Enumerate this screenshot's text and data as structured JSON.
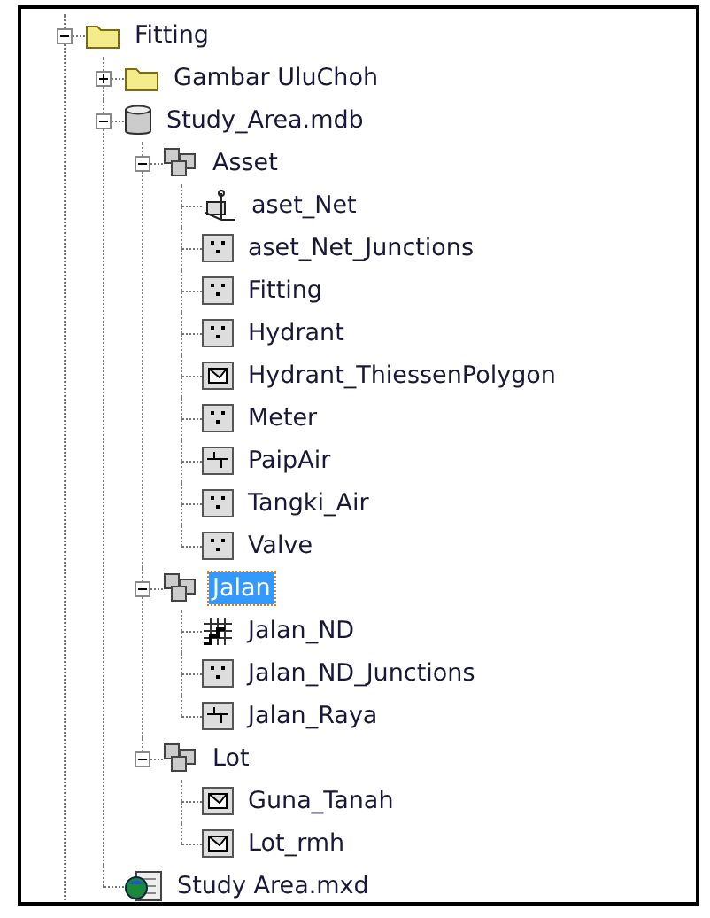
{
  "tree": [
    {
      "label": "Fitting",
      "kind": "folder",
      "expanded": true,
      "selected": false,
      "children": [
        {
          "label": "Gambar UluChoh",
          "kind": "folder",
          "expanded": false,
          "selected": false
        },
        {
          "label": "Study_Area.mdb",
          "kind": "geodatabase",
          "expanded": true,
          "selected": false,
          "children": [
            {
              "label": "Asset",
              "kind": "dataset",
              "expanded": true,
              "selected": false,
              "children": [
                {
                  "label": "aset_Net",
                  "kind": "geometric_network",
                  "selected": false
                },
                {
                  "label": "aset_Net_Junctions",
                  "kind": "point",
                  "selected": false
                },
                {
                  "label": "Fitting",
                  "kind": "point",
                  "selected": false
                },
                {
                  "label": "Hydrant",
                  "kind": "point",
                  "selected": false
                },
                {
                  "label": "Hydrant_ThiessenPolygon",
                  "kind": "polygon",
                  "selected": false
                },
                {
                  "label": "Meter",
                  "kind": "point",
                  "selected": false
                },
                {
                  "label": "PaipAir",
                  "kind": "line",
                  "selected": false
                },
                {
                  "label": "Tangki_Air",
                  "kind": "point",
                  "selected": false
                },
                {
                  "label": "Valve",
                  "kind": "point",
                  "selected": false
                }
              ]
            },
            {
              "label": "Jalan",
              "kind": "dataset",
              "expanded": true,
              "selected": true,
              "children": [
                {
                  "label": "Jalan_ND",
                  "kind": "network_dataset",
                  "selected": false
                },
                {
                  "label": "Jalan_ND_Junctions",
                  "kind": "point",
                  "selected": false
                },
                {
                  "label": "Jalan_Raya",
                  "kind": "line",
                  "selected": false
                }
              ]
            },
            {
              "label": "Lot",
              "kind": "dataset",
              "expanded": true,
              "selected": false,
              "children": [
                {
                  "label": "Guna_Tanah",
                  "kind": "polygon",
                  "selected": false
                },
                {
                  "label": "Lot_rmh",
                  "kind": "polygon",
                  "selected": false
                }
              ]
            }
          ]
        },
        {
          "label": "Study Area.mxd",
          "kind": "map_document",
          "selected": false
        }
      ]
    }
  ]
}
